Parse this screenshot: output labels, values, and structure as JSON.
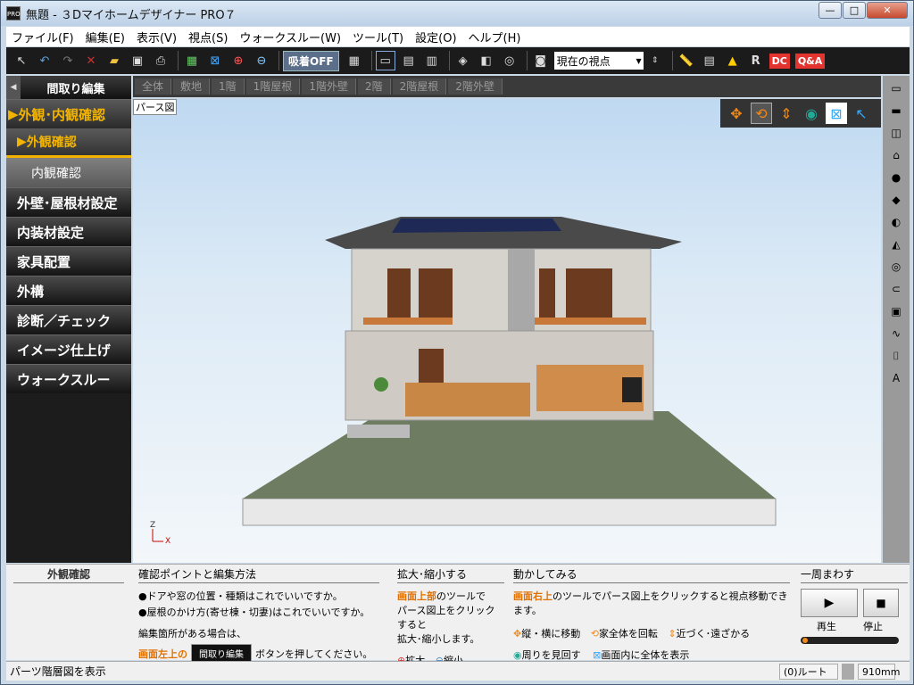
{
  "window": {
    "title": "無題 - ３Dマイホームデザイナー PRO７",
    "app_icon": "PRO",
    "minimize": "—",
    "maximize": "□",
    "close": "✕"
  },
  "menu": [
    "ファイル(F)",
    "編集(E)",
    "表示(V)",
    "視点(S)",
    "ウォークスルー(W)",
    "ツール(T)",
    "設定(O)",
    "ヘルプ(H)"
  ],
  "toolbar": {
    "kyuchaku": "吸着OFF",
    "view_select": "現在の視点",
    "dc_label": "DC",
    "qa_label": "Q&A",
    "r_label": "R"
  },
  "left_panel": {
    "header": "間取り編集",
    "collapse_arrow": "◀",
    "items": [
      {
        "label": "外観･内観確認",
        "active": true
      },
      {
        "label": "外観確認",
        "sub": true,
        "selected": true
      },
      {
        "label": "内観確認",
        "sub": true
      },
      {
        "label": "外壁･屋根材設定"
      },
      {
        "label": "内装材設定"
      },
      {
        "label": "家具配置"
      },
      {
        "label": "外構"
      },
      {
        "label": "診断／チェック"
      },
      {
        "label": "イメージ仕上げ"
      },
      {
        "label": "ウォークスルー"
      }
    ]
  },
  "layer_tabs": [
    "全体",
    "敷地",
    "1階",
    "1階屋根",
    "1階外壁",
    "2階",
    "2階屋根",
    "2階外壁"
  ],
  "view": {
    "label": "パース図",
    "axis_z": "Z",
    "axis_x": "X"
  },
  "view_tools": [
    "move-icon",
    "rotate-icon",
    "updown-icon",
    "lookaround-icon",
    "fit-icon",
    "pointer-icon"
  ],
  "bottom": {
    "mode_title": "外観確認",
    "section1": {
      "header": "確認ポイントと編集方法",
      "line1": "●ドアや窓の位置・種類はこれでいいですか。",
      "line2": "●屋根のかけ方(寄せ棟・切妻)はこれでいいですか。",
      "line3": "編集箇所がある場合は、",
      "line4_hl": "画面左上の",
      "line4_btn": "間取り編集",
      "line4_end": "ボタンを押してください。"
    },
    "section2": {
      "header": "拡大･縮小する",
      "text_hl": "画面上部",
      "text1": "のツールで",
      "text2": "パース図上をクリックすると",
      "text3": "拡大･縮小します。",
      "zoom_in": "拡大",
      "zoom_out": "縮小"
    },
    "section3": {
      "header": "動かしてみる",
      "text_hl": "画面右上",
      "text": "のツールでパース図上をクリックすると視点移動できます。",
      "move": "縦・横に移動",
      "rotate": "家全体を回転",
      "updown": "近づく･遠ざかる",
      "lookaround": "周りを見回す",
      "fit": "画面内に全体を表示"
    },
    "section4": {
      "header": "一周まわす",
      "play": "再生",
      "stop": "停止"
    }
  },
  "status": {
    "left": "パーツ階層図を表示",
    "route": "(0)ルート",
    "size": "910mm"
  }
}
